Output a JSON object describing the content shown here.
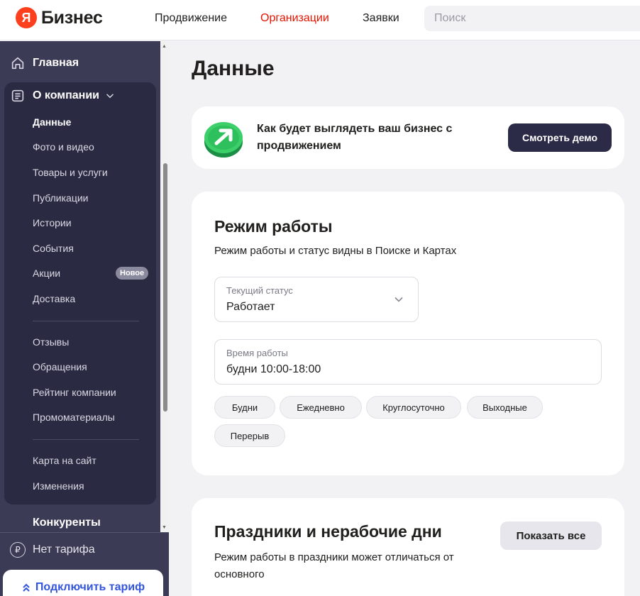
{
  "header": {
    "logo_letter": "Я",
    "logo_text": "Бизнес",
    "nav": [
      {
        "label": "Продвижение",
        "active": false
      },
      {
        "label": "Организации",
        "active": true
      },
      {
        "label": "Заявки",
        "active": false
      }
    ],
    "search_placeholder": "Поиск",
    "active_color": "#e61400"
  },
  "sidebar": {
    "home_label": "Главная",
    "home_icon": "home-icon",
    "about_label": "О компании",
    "about_icon": "document-icon",
    "items_group1": [
      "Данные",
      "Фото и видео",
      "Товары и услуги",
      "Публикации",
      "Истории",
      "События",
      "Акции",
      "Доставка"
    ],
    "items_group2": [
      "Отзывы",
      "Обращения",
      "Рейтинг компании",
      "Промоматериалы"
    ],
    "items_group3": [
      "Карта на сайт",
      "Изменения"
    ],
    "current_item": "Данные",
    "new_badge": "Новое",
    "competitors_label": "Конкуренты",
    "tariff_label": "Нет тарифа",
    "tariff_icon": "ruble-icon",
    "connect_label": "Подключить тариф",
    "connect_icon": "chevrons-up-icon",
    "bg_color": "#3b3b55",
    "group_bg_color": "#2a2a42"
  },
  "main": {
    "title": "Данные",
    "promo": {
      "text": "Как будет выглядеть ваш бизнес с продвижением",
      "button": "Смотреть демо",
      "icon": "arrow-up-right-icon"
    },
    "hours": {
      "title": "Режим работы",
      "subtitle": "Режим работы и статус видны в Поиске и Картах",
      "status_label": "Текущий статус",
      "status_value": "Работает",
      "time_label": "Время работы",
      "time_value": "будни 10:00-18:00",
      "chips": [
        "Будни",
        "Ежедневно",
        "Круглосуточно",
        "Выходные",
        "Перерыв"
      ]
    },
    "holidays": {
      "title": "Праздники и нерабочие дни",
      "subtitle": "Режим работы в праздники может отличаться от основного",
      "button": "Показать все"
    }
  }
}
